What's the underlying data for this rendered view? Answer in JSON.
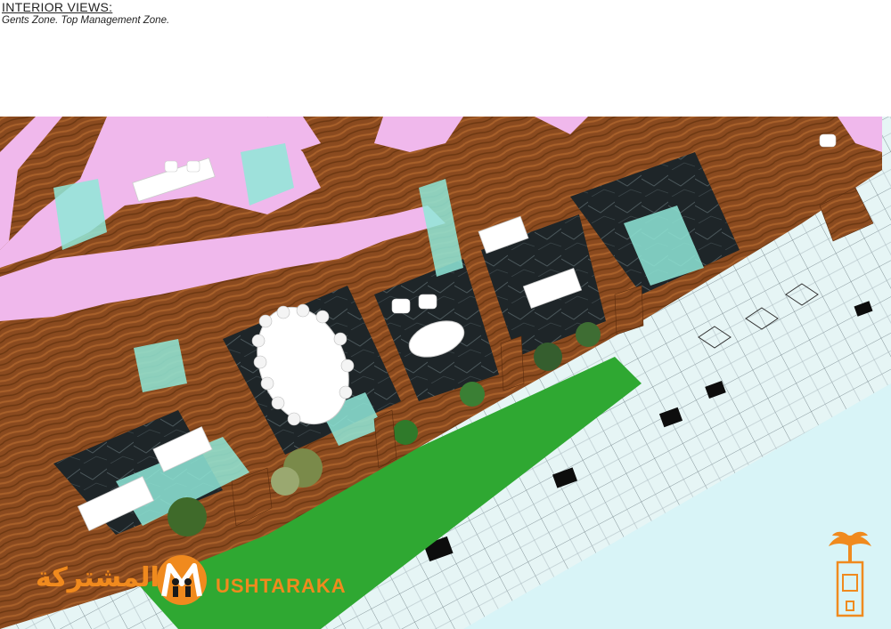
{
  "header": {
    "title": "INTERIOR VIEWS:",
    "subtitle": "Gents Zone. Top Management Zone."
  },
  "logo": {
    "arabic_text": "المشتركة",
    "wordmark": "USHTARAKA"
  },
  "colors": {
    "wood": "#8a4a1f",
    "ceiling_pink": "#f0b8ec",
    "glass": "#8fe8d8",
    "grass": "#2fa832",
    "floor_tile": "#e6f5f5",
    "dark_floor": "#1e2528",
    "brand_orange": "#f08a1e"
  }
}
